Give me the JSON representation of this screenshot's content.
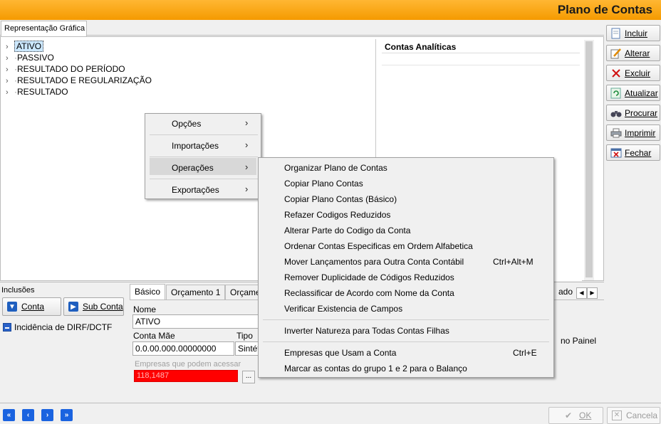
{
  "window": {
    "title": "Plano de Contas"
  },
  "tabs": {
    "main": "Representação Gráfica"
  },
  "tree": {
    "items": [
      {
        "label": "ATIVO",
        "selected": true
      },
      {
        "label": "PASSIVO",
        "selected": false
      },
      {
        "label": "RESULTADO DO PERÍODO",
        "selected": false
      },
      {
        "label": "RESULTADO E REGULARIZAÇÃO",
        "selected": false
      },
      {
        "label": "RESULTADO",
        "selected": false
      }
    ]
  },
  "contas": {
    "header": "Contas Analíticas"
  },
  "toolbar": {
    "buttons": [
      {
        "label": "Incluir",
        "icon": "document-icon"
      },
      {
        "label": "Alterar",
        "icon": "edit-icon"
      },
      {
        "label": "Excluir",
        "icon": "delete-icon"
      },
      {
        "label": "Atualizar",
        "icon": "refresh-icon"
      },
      {
        "label": "Procurar",
        "icon": "binoculars-icon"
      },
      {
        "label": "Imprimir",
        "icon": "printer-icon"
      },
      {
        "label": "Fechar",
        "icon": "close-window-icon"
      }
    ]
  },
  "bottom": {
    "inclusoes_label": "Inclusões",
    "conta_button": "Conta",
    "subconta_button": "Sub Conta",
    "dirf_label": "Incidência de DIRF/DCTF",
    "tabs": [
      "Básico",
      "Orçamento 1",
      "Orçame",
      "ado"
    ],
    "nome_label": "Nome",
    "nome_value": "ATIVO",
    "conta_mae_label": "Conta Mãe",
    "conta_mae_value": "0.0.00.000.00000000",
    "tipo_label": "Tipo",
    "tipo_value": "Sintét",
    "empresas_placeholder": "Empresas que podem acessar",
    "empresas_value": "118,1487",
    "ellipsis": "...",
    "painel_text": "no Painel"
  },
  "context_menu": {
    "items": [
      {
        "label": "Opções",
        "submenu": true
      },
      {
        "label": "Importações",
        "submenu": true
      },
      {
        "label": "Operações",
        "submenu": true,
        "highlighted": true
      },
      {
        "label": "Exportações",
        "submenu": true
      }
    ]
  },
  "submenu": {
    "group1": [
      {
        "label": "Organizar Plano de Contas",
        "shortcut": ""
      },
      {
        "label": "Copiar Plano Contas",
        "shortcut": ""
      },
      {
        "label": "Copiar Plano Contas (Básico)",
        "shortcut": ""
      },
      {
        "label": "Refazer Codigos Reduzidos",
        "shortcut": ""
      },
      {
        "label": "Alterar Parte do Codigo da Conta",
        "shortcut": ""
      },
      {
        "label": "Ordenar Contas Especificas em Ordem Alfabetica",
        "shortcut": ""
      },
      {
        "label": "Mover Lançamentos para Outra Conta Contábil",
        "shortcut": "Ctrl+Alt+M"
      },
      {
        "label": "Remover Duplicidade de Códigos Reduzidos",
        "shortcut": ""
      },
      {
        "label": "Reclassificar de Acordo com Nome da Conta",
        "shortcut": ""
      },
      {
        "label": "Verificar Existencia de Campos",
        "shortcut": ""
      }
    ],
    "group2": [
      {
        "label": "Inverter Natureza para Todas Contas Filhas",
        "shortcut": ""
      }
    ],
    "group3": [
      {
        "label": "Empresas que Usam a Conta",
        "shortcut": "Ctrl+E"
      },
      {
        "label": "Marcar as contas do grupo 1 e 2 para o Balanço",
        "shortcut": ""
      }
    ]
  },
  "footer": {
    "ok_label": "OK",
    "cancel_label": "Cancela"
  }
}
